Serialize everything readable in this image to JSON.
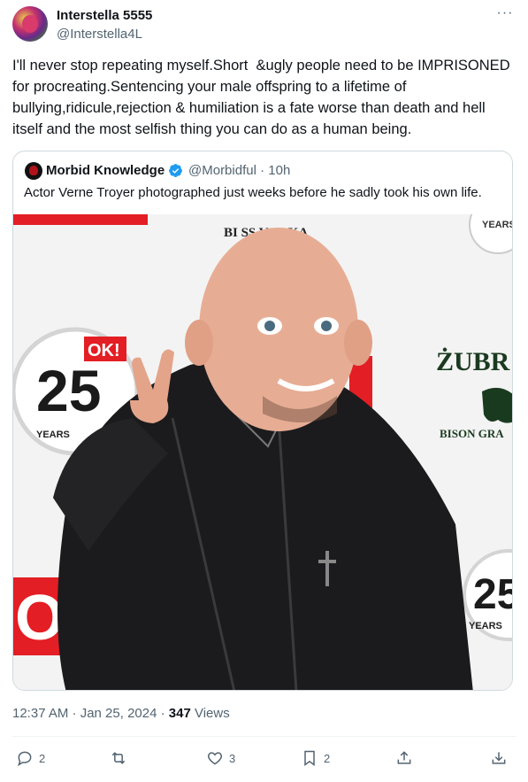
{
  "tweet": {
    "author_name": "Interstella 5555",
    "author_handle": "@Interstella4L",
    "more_label": "···",
    "body": "I'll never stop repeating myself.Short  &ugly people need to be IMPRISONED for procreating.Sentencing your male offspring to a lifetime of bullying,ridicule,rejection & humiliation is a fate worse than death and hell itself and the most selfish thing you can do as a human being.",
    "quote": {
      "author_name": "Morbid Knowledge",
      "author_handle": "@Morbidful",
      "time": "10h",
      "separator": "·",
      "text": "Actor Verne Troyer photographed just weeks before he sadly took his own life.",
      "photo_text": {
        "top_banner": "BI        SS VODKA",
        "ok_logo": "OK!",
        "years_number": "25",
        "years_label": "YEARS",
        "zubr": "ŻUBR",
        "bison": "BISON GRA",
        "big_ok": "OK!",
        "right_years_number": "25",
        "right_years_label": "YEARS",
        "top_right_years": "YEARS"
      }
    },
    "timestamp": "12:37 AM · Jan 25, 2024 · ",
    "views_count": "347",
    "views_label": " Views",
    "actions": {
      "replies": "2",
      "retweets": "",
      "likes": "3",
      "bookmarks": "2"
    }
  },
  "colors": {
    "text_primary": "#0f1419",
    "text_secondary": "#536471",
    "verified": "#1d9bf0",
    "border": "#cfd9de",
    "ok_red": "#e31e24"
  }
}
